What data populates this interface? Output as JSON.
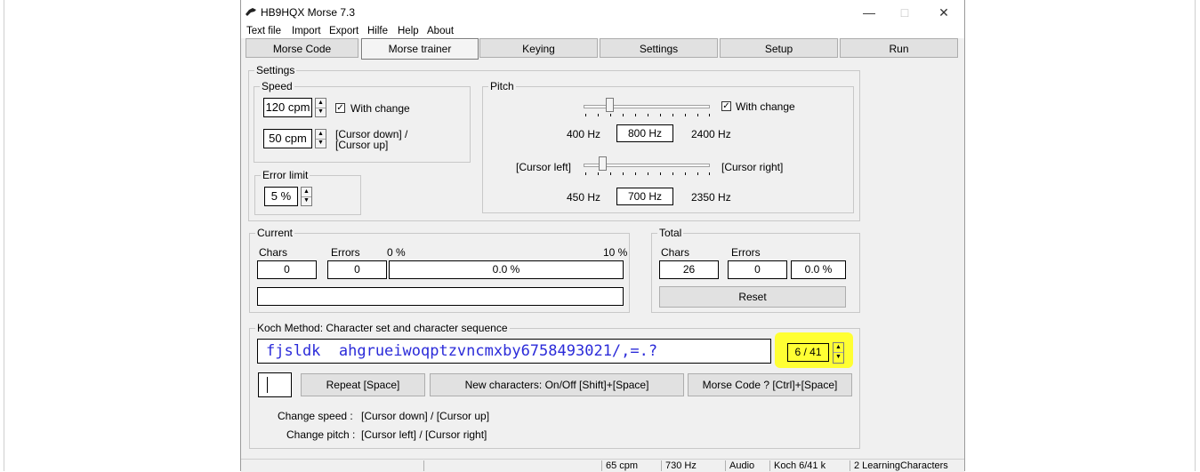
{
  "window": {
    "title": "HB9HQX Morse 7.3",
    "controls": {
      "minimize": "—",
      "maximize": "□",
      "close": "✕"
    }
  },
  "menu": [
    "Text file",
    "Import",
    "Export",
    "Hilfe",
    "Help",
    "About"
  ],
  "tabs": [
    "Morse Code",
    "Morse trainer",
    "Keying",
    "Settings",
    "Setup",
    "Run"
  ],
  "active_tab": "Morse trainer",
  "settings": {
    "legend": "Settings",
    "speed": {
      "legend": "Speed",
      "value": "120 cpm",
      "with_change": "With change",
      "change_value": "50 cpm",
      "change_hint_1": "[Cursor down] /",
      "change_hint_2": "[Cursor up]"
    },
    "error_limit": {
      "legend": "Error limit",
      "value": "5 %"
    },
    "pitch": {
      "legend": "Pitch",
      "with_change": "With change",
      "min1": "400 Hz",
      "value1": "800 Hz",
      "max1": "2400 Hz",
      "cursor_left": "[Cursor left]",
      "cursor_right": "[Cursor right]",
      "min2": "450 Hz",
      "value2": "700 Hz",
      "max2": "2350 Hz"
    }
  },
  "current": {
    "legend": "Current",
    "chars_label": "Chars",
    "errors_label": "Errors",
    "pct_low": "0 %",
    "pct_high": "10 %",
    "chars": "0",
    "errors": "0",
    "error_pct": "0.0 %"
  },
  "total": {
    "legend": "Total",
    "chars_label": "Chars",
    "errors_label": "Errors",
    "chars": "26",
    "errors": "0",
    "error_pct": "0.0 %",
    "reset": "Reset"
  },
  "koch": {
    "legend": "Koch Method: Character set and character sequence",
    "sequence": "fjsldk  ahgrueiwoqptzvncmxby6758493021/,=.?",
    "level": "6 / 41",
    "highlight_color": "#ffff33",
    "repeat_button": "Repeat  [Space]",
    "new_chars_button": "New characters: On/Off  [Shift]+[Space]",
    "morse_code_button": "Morse Code ?  [Ctrl]+[Space]",
    "help_speed_label": "Change speed :",
    "help_speed_keys": "[Cursor down] / [Cursor up]",
    "help_pitch_label": "Change pitch :",
    "help_pitch_keys": "[Cursor left] / [Cursor right]"
  },
  "status": {
    "speed": "65 cpm",
    "pitch": "730 Hz",
    "mode": "Audio",
    "koch": "Koch 6/41  k",
    "learning": "2 LearningCharacters"
  }
}
